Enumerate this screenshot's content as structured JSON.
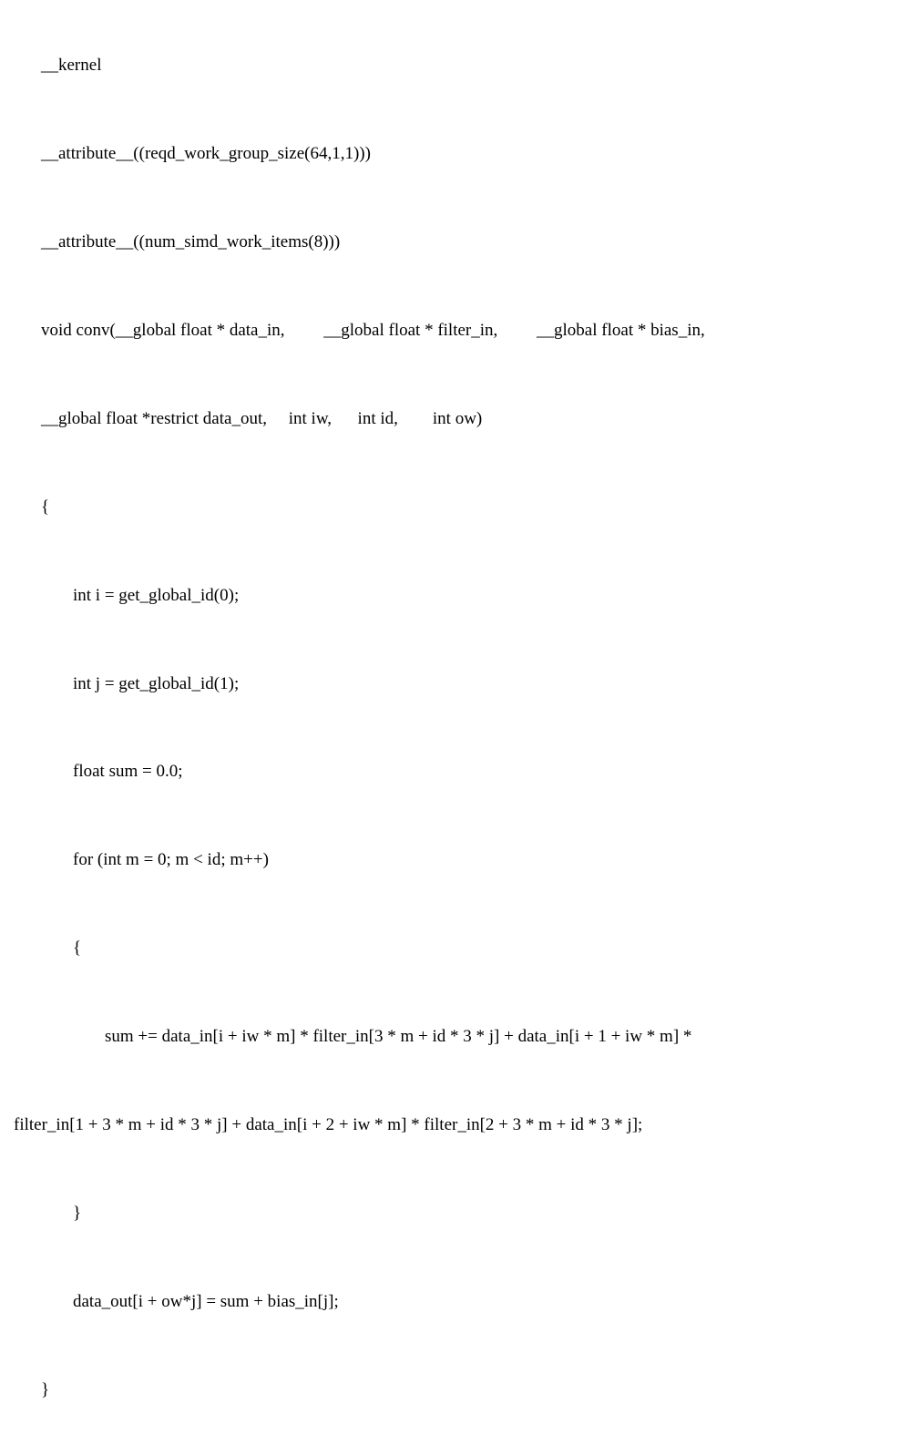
{
  "code": {
    "l1": "__kernel",
    "l2": "__attribute__((reqd_work_group_size(64,1,1)))",
    "l3": "__attribute__((num_simd_work_items(8)))",
    "l4": "void conv(__global float * data_in,         __global float * filter_in,         __global float * bias_in,",
    "l5": "__global float *restrict data_out,     int iw,      int id,        int ow)",
    "l6": "{",
    "l7": "int i = get_global_id(0);",
    "l8": "int j = get_global_id(1);",
    "l9": "float sum = 0.0;",
    "l10": "for (int m = 0; m < id; m++)",
    "l11": "{",
    "l12a": "sum += data_in[i + iw * m] * filter_in[3 * m + id * 3 * j] + data_in[i + 1 + iw * m] *",
    "l12b": "filter_in[1 + 3 * m + id * 3 * j] + data_in[i + 2 + iw * m] * filter_in[2 + 3 * m + id * 3 * j];",
    "l13": "}",
    "l14": "data_out[i + ow*j] = sum + bias_in[j];",
    "l15": "}"
  }
}
